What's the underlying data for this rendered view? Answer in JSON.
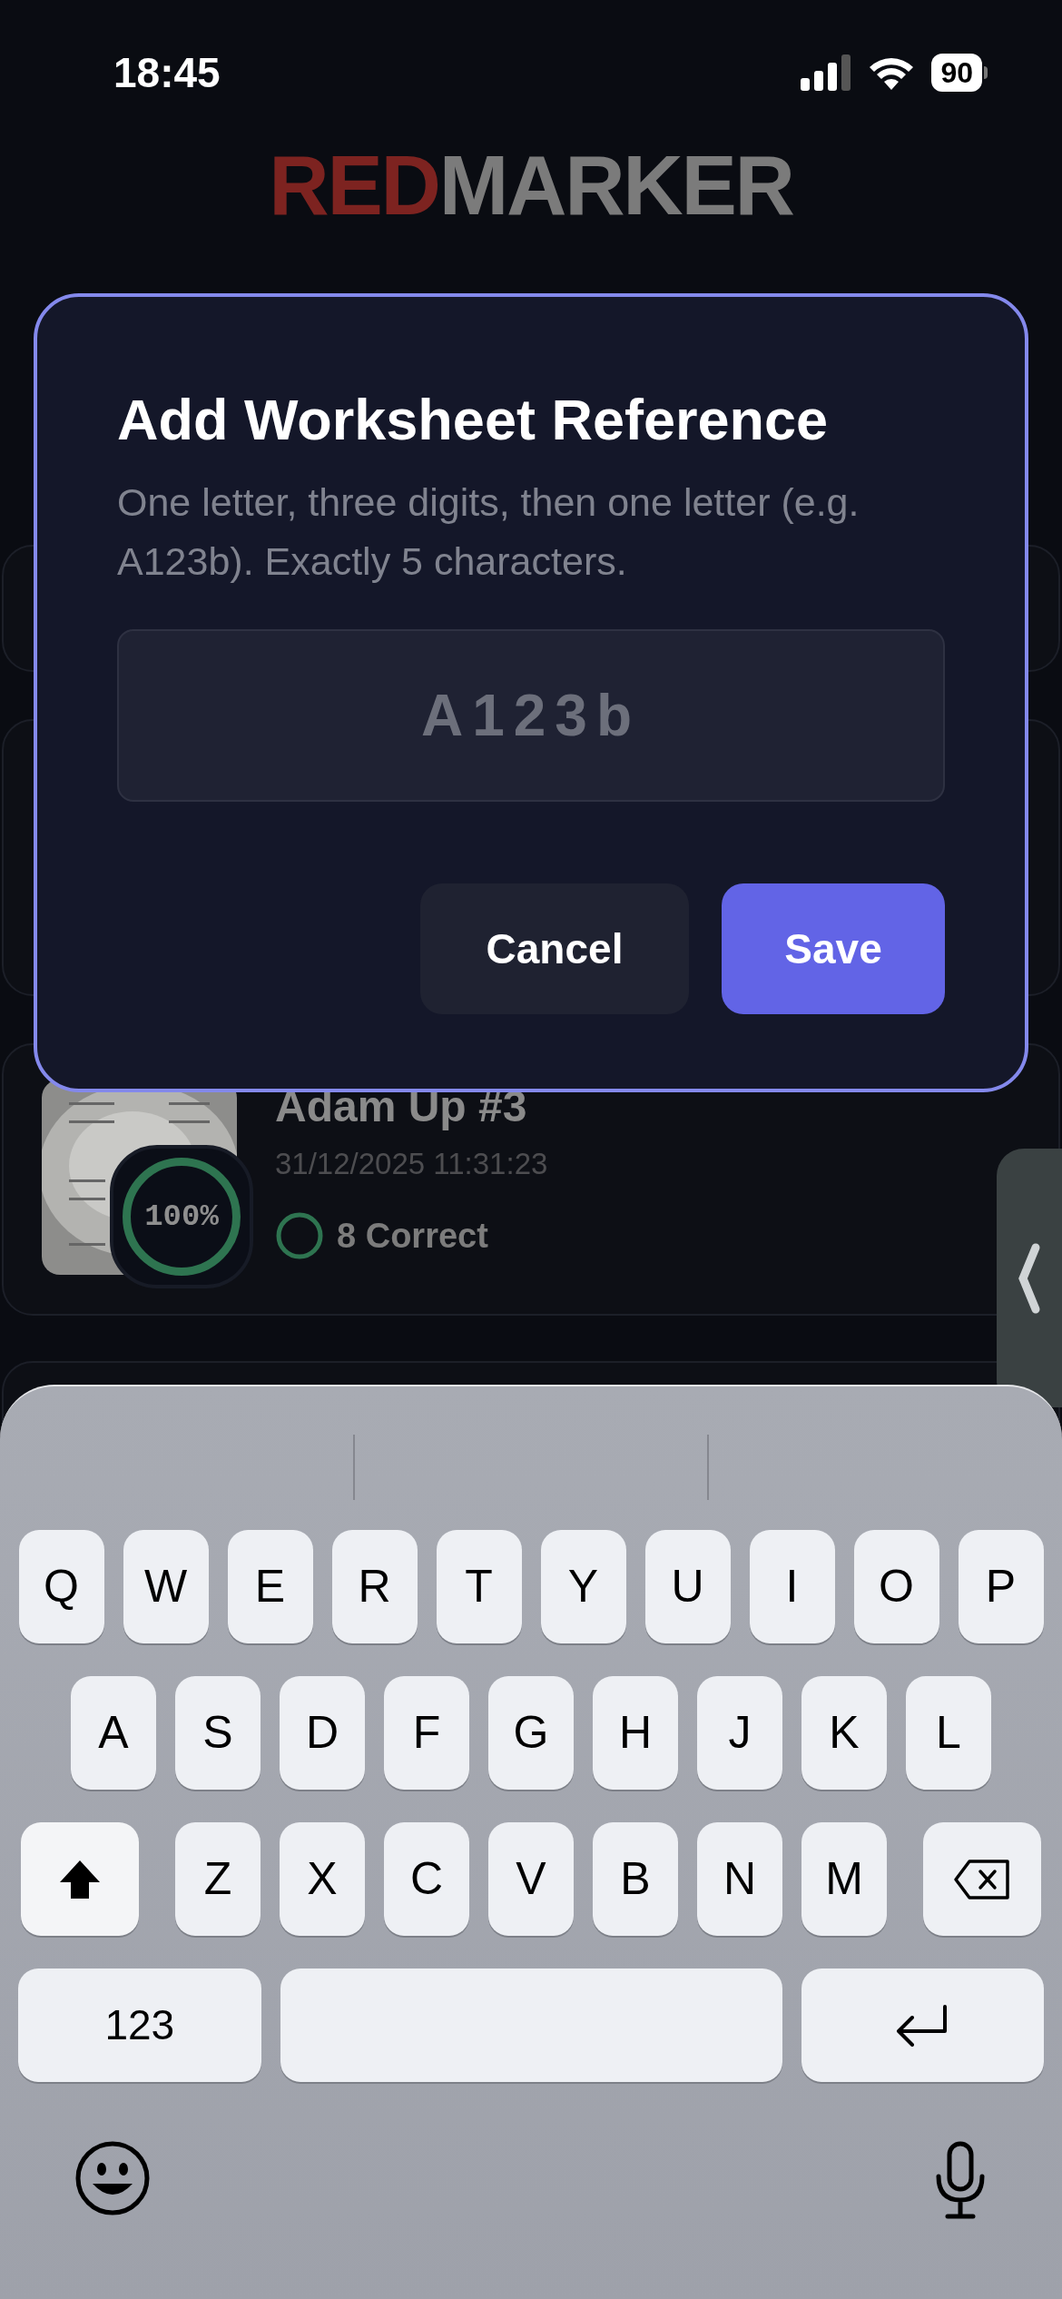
{
  "status_bar": {
    "time": "18:45",
    "battery": "90"
  },
  "logo": [
    {
      "text": "RED",
      "color": "#7d2320"
    },
    {
      "text": "MARKER",
      "color": "#7b7b7b"
    }
  ],
  "result_card": {
    "title": "Adam Up #3",
    "date": "31/12/2025 11:31:23",
    "score": "100%",
    "result": "8 Correct"
  },
  "dialog": {
    "title": "Add Worksheet Reference",
    "description": "One letter, three digits, then one letter (e.g. A123b). Exactly 5 characters.",
    "input": {
      "placeholder": "A123b"
    },
    "buttons": [
      {
        "label": "Cancel",
        "kind": "secondary"
      },
      {
        "label": "Save",
        "kind": "primary"
      }
    ]
  },
  "keyboard": {
    "rows": [
      [
        {
          "kind": "letter",
          "label": "Q"
        },
        {
          "kind": "letter",
          "label": "W"
        },
        {
          "kind": "letter",
          "label": "E"
        },
        {
          "kind": "letter",
          "label": "R"
        },
        {
          "kind": "letter",
          "label": "T"
        },
        {
          "kind": "letter",
          "label": "Y"
        },
        {
          "kind": "letter",
          "label": "U"
        },
        {
          "kind": "letter",
          "label": "I"
        },
        {
          "kind": "letter",
          "label": "O"
        },
        {
          "kind": "letter",
          "label": "P"
        }
      ],
      [
        {
          "kind": "letter",
          "label": "A"
        },
        {
          "kind": "letter",
          "label": "S"
        },
        {
          "kind": "letter",
          "label": "D"
        },
        {
          "kind": "letter",
          "label": "F"
        },
        {
          "kind": "letter",
          "label": "G"
        },
        {
          "kind": "letter",
          "label": "H"
        },
        {
          "kind": "letter",
          "label": "J"
        },
        {
          "kind": "letter",
          "label": "K"
        },
        {
          "kind": "letter",
          "label": "L"
        }
      ],
      [
        {
          "kind": "shift",
          "on": true
        },
        {
          "kind": "letter",
          "label": "Z"
        },
        {
          "kind": "letter",
          "label": "X"
        },
        {
          "kind": "letter",
          "label": "C"
        },
        {
          "kind": "letter",
          "label": "V"
        },
        {
          "kind": "letter",
          "label": "B"
        },
        {
          "kind": "letter",
          "label": "N"
        },
        {
          "kind": "letter",
          "label": "M"
        },
        {
          "kind": "delete"
        }
      ],
      [
        {
          "kind": "numbers",
          "label": "123"
        },
        {
          "kind": "space"
        },
        {
          "kind": "return"
        }
      ]
    ],
    "bottom": [
      {
        "kind": "emoji"
      },
      {
        "kind": "mic"
      }
    ]
  }
}
